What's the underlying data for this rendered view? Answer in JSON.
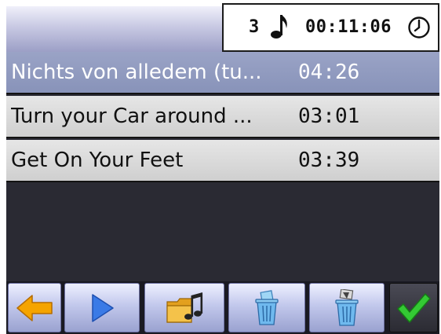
{
  "header": {
    "track_count": "3",
    "total_time": "00:11:06",
    "note_icon": "music-note-icon",
    "clock_icon": "clock-icon"
  },
  "playlist": {
    "items": [
      {
        "title": "Nichts von alledem (tu...",
        "duration": "04:26",
        "selected": true
      },
      {
        "title": "Turn your Car around ...",
        "duration": "03:01",
        "selected": false
      },
      {
        "title": "Get On Your Feet",
        "duration": "03:39",
        "selected": false
      }
    ]
  },
  "toolbar": {
    "buttons": [
      {
        "name": "back-button",
        "icon": "arrow-left-icon"
      },
      {
        "name": "play-button",
        "icon": "play-icon"
      },
      {
        "name": "add-music-folder-button",
        "icon": "music-folder-icon"
      },
      {
        "name": "delete-button",
        "icon": "trash-icon"
      },
      {
        "name": "delete-all-button",
        "icon": "trash-all-icon"
      },
      {
        "name": "confirm-button",
        "icon": "checkmark-icon"
      }
    ]
  },
  "colors": {
    "selected_row": "#8f99bf",
    "normal_row": "#d8d8d8",
    "list_background": "#2a2a33",
    "header_gradient_bottom": "#9c9fc6",
    "back_arrow": "#f5a400",
    "play_triangle": "#2f6fe0",
    "checkmark": "#2fbf2f"
  }
}
